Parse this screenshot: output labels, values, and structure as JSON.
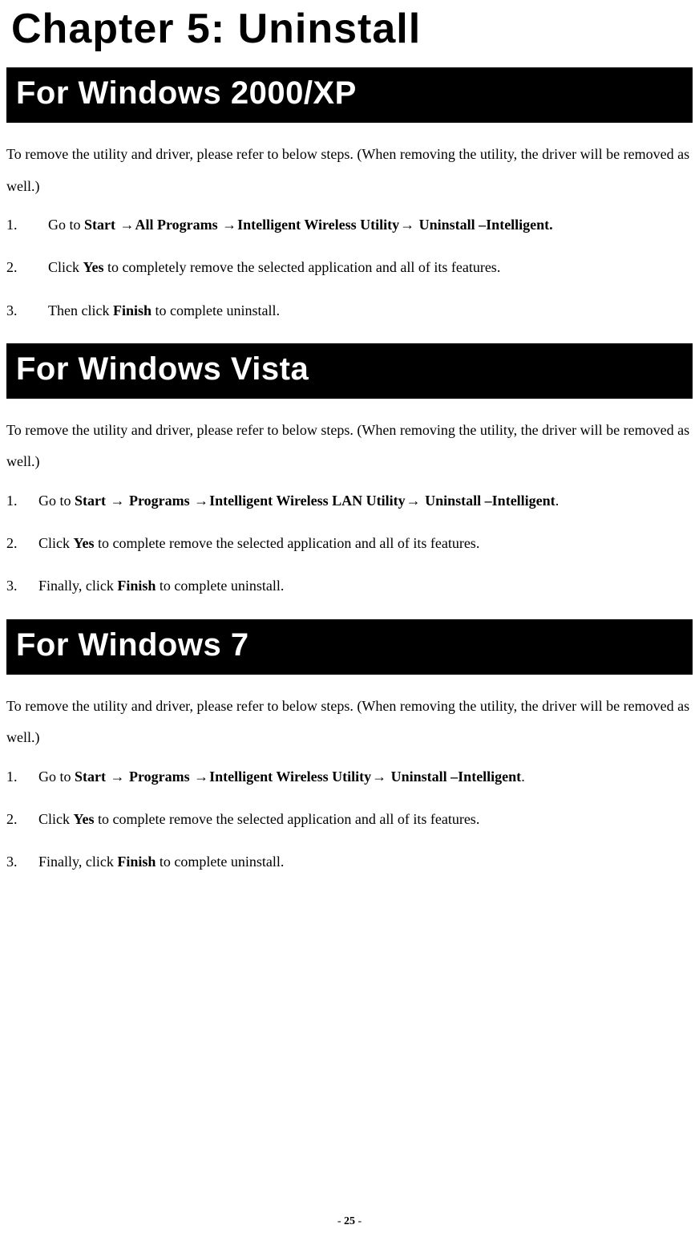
{
  "chapter_title": "Chapter 5: Uninstall",
  "page_number": "25",
  "intro_text": "To remove the utility and driver, please refer to below steps. (When removing the utility, the driver will be removed as well.)",
  "arrow": "→",
  "strings": {
    "start": "Start",
    "all_programs": "All Programs",
    "programs": "Programs",
    "iwu": "Intelligent Wireless Utility",
    "iwlu": "Intelligent Wireless LAN Utility",
    "uninstall_intelligent": " Uninstall –Intelligent.",
    "uninstall_intelligent_nodot": " Uninstall –Intelligent",
    "yes": "Yes",
    "finish": "Finish",
    "goto": "Go to ",
    "click": "Click ",
    "then_click": "Then click ",
    "finally_click": "Finally, click ",
    "s1_xp_tail": " to completely remove the selected application and all of its features.",
    "s1_tail": " to complete remove the selected application and all of its features.",
    "s3_tail": " to complete uninstall.",
    "period": "."
  },
  "sections": {
    "s1": {
      "title": "For Windows 2000/XP"
    },
    "s2": {
      "title": "For Windows Vista"
    },
    "s3": {
      "title": "For Windows 7"
    }
  }
}
